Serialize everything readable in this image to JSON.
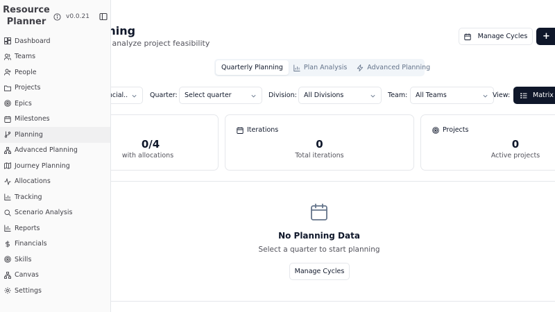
{
  "sidebar": {
    "brand": "Resource Planner",
    "version": "v0.0.21",
    "items": [
      {
        "label": "Dashboard",
        "icon": "dashboard-icon"
      },
      {
        "label": "Teams",
        "icon": "users-icon"
      },
      {
        "label": "People",
        "icon": "user-plus-icon"
      },
      {
        "label": "Projects",
        "icon": "folder-icon"
      },
      {
        "label": "Epics",
        "icon": "target-icon"
      },
      {
        "label": "Milestones",
        "icon": "calendar-icon"
      },
      {
        "label": "Planning",
        "icon": "git-branch-icon",
        "active": true
      },
      {
        "label": "Advanced Planning",
        "icon": "network-icon"
      },
      {
        "label": "Journey Planning",
        "icon": "map-icon"
      },
      {
        "label": "Allocations",
        "icon": "activity-icon"
      },
      {
        "label": "Tracking",
        "icon": "bar-chart-icon"
      },
      {
        "label": "Scenario Analysis",
        "icon": "search-icon"
      },
      {
        "label": "Reports",
        "icon": "bar-chart-icon"
      },
      {
        "label": "Financials",
        "icon": "dollar-icon"
      },
      {
        "label": "Skills",
        "icon": "target-icon"
      },
      {
        "label": "Canvas",
        "icon": "network-icon"
      },
      {
        "label": "Settings",
        "icon": "gear-icon"
      }
    ]
  },
  "header": {
    "title": "nning",
    "subtitle": "nd analyze project feasibility",
    "manage_cycles": "Manage Cycles",
    "add_label": "+"
  },
  "tabs": [
    {
      "label": "Quarterly Planning",
      "active": true
    },
    {
      "label": "Plan Analysis",
      "icon": "bar-chart-icon"
    },
    {
      "label": "Advanced Planning",
      "icon": "zap-icon"
    }
  ],
  "filters": {
    "first_value": "ancial..",
    "quarter_label": "Quarter:",
    "quarter_value": "Select quarter",
    "division_label": "Division:",
    "division_value": "All Divisions",
    "team_label": "Team:",
    "team_value": "All Teams",
    "view_label": "View:",
    "view_value": "Matrix"
  },
  "cards": [
    {
      "title": "",
      "value": "0/4",
      "sub": "with allocations"
    },
    {
      "title": "Iterations",
      "value": "0",
      "sub": "Total iterations",
      "icon": "calendar-icon"
    },
    {
      "title": "Projects",
      "value": "0",
      "sub": "Active projects",
      "icon": "target-icon"
    }
  ],
  "empty": {
    "title": "No Planning Data",
    "subtitle": "Select a quarter to start planning",
    "button": "Manage Cycles"
  }
}
